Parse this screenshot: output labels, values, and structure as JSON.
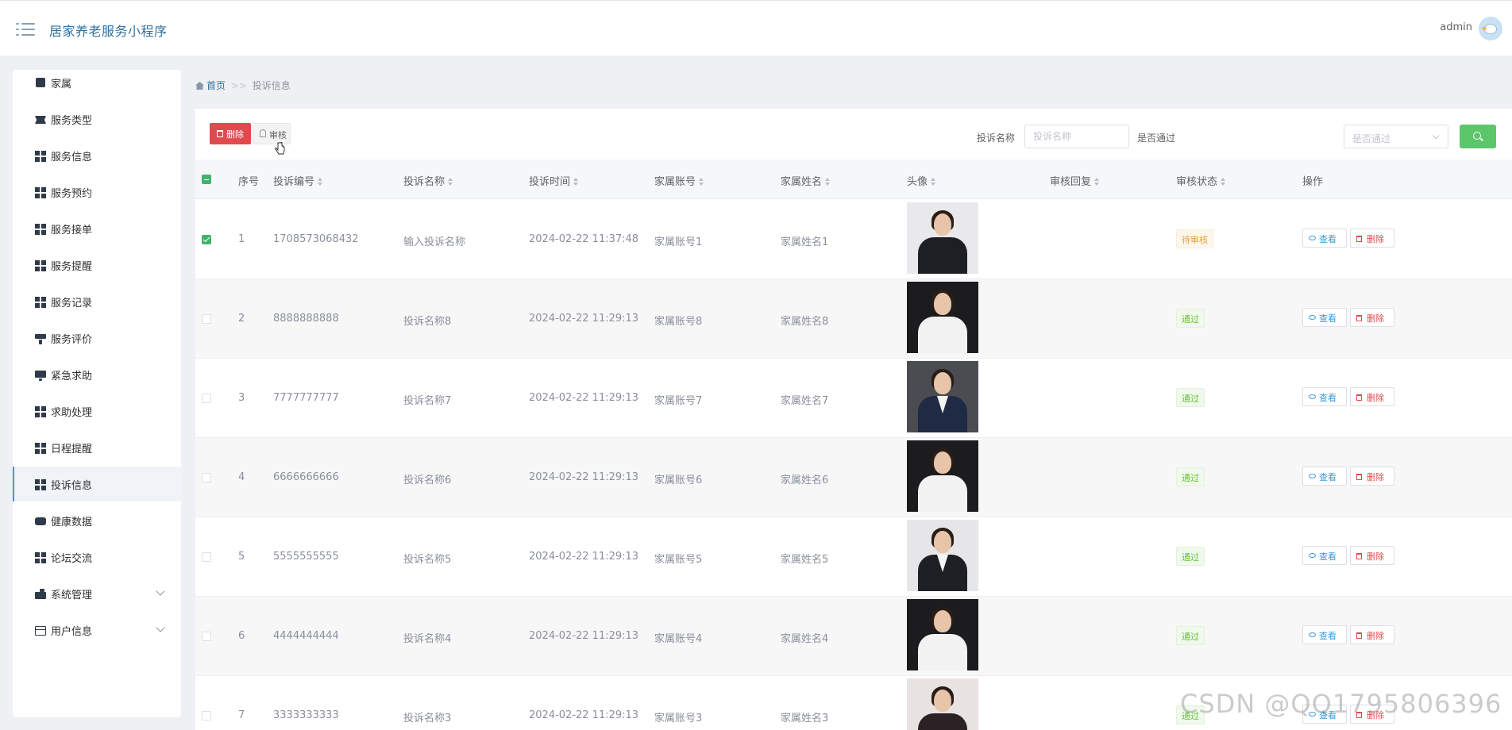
{
  "header": {
    "title": "居家养老服务小程序",
    "user": "admin"
  },
  "sidebar": {
    "items": [
      {
        "label": "家属",
        "icon": "family-icon"
      },
      {
        "label": "服务类型",
        "icon": "ticket-icon"
      },
      {
        "label": "服务信息",
        "icon": "grid-icon"
      },
      {
        "label": "服务预约",
        "icon": "grid-icon"
      },
      {
        "label": "服务接单",
        "icon": "grid-icon"
      },
      {
        "label": "服务提醒",
        "icon": "grid-icon"
      },
      {
        "label": "服务记录",
        "icon": "grid-icon"
      },
      {
        "label": "服务评价",
        "icon": "brush-icon"
      },
      {
        "label": "紧急求助",
        "icon": "monitor-icon"
      },
      {
        "label": "求助处理",
        "icon": "grid-icon"
      },
      {
        "label": "日程提醒",
        "icon": "grid-icon"
      },
      {
        "label": "投诉信息",
        "icon": "grid-icon",
        "active": true
      },
      {
        "label": "健康数据",
        "icon": "tray-icon"
      },
      {
        "label": "论坛交流",
        "icon": "grid-icon"
      },
      {
        "label": "系统管理",
        "icon": "settings-icon",
        "expandable": true
      },
      {
        "label": "用户信息",
        "icon": "card-icon",
        "expandable": true
      }
    ]
  },
  "breadcrumb": {
    "home": "首页",
    "sep": ">>",
    "current": "投诉信息"
  },
  "toolbar": {
    "delete_label": "删除",
    "audit_label": "审核",
    "search_name_label": "投诉名称",
    "search_name_placeholder": "投诉名称",
    "pass_label": "是否通过",
    "pass_placeholder": "是否通过"
  },
  "table": {
    "columns": [
      "序号",
      "投诉编号",
      "投诉名称",
      "投诉时间",
      "家属账号",
      "家属姓名",
      "头像",
      "审核回复",
      "审核状态",
      "操作"
    ],
    "view_label": "查看",
    "delete_label": "删除",
    "rows": [
      {
        "index": "1",
        "code": "1708573068432",
        "name": "输入投诉名称",
        "time": "2024-02-22 11:37:48",
        "account": "家属账号1",
        "fullname": "家属姓名1",
        "reply": "",
        "status": "待审核",
        "status_type": "pending",
        "checked": true,
        "photo": {
          "bg": "#e9e9ec",
          "suit": "#1e1f24",
          "shirt": false
        }
      },
      {
        "index": "2",
        "code": "8888888888",
        "name": "投诉名称8",
        "time": "2024-02-22 11:29:13",
        "account": "家属账号8",
        "fullname": "家属姓名8",
        "reply": "",
        "status": "通过",
        "status_type": "pass",
        "checked": false,
        "photo": {
          "bg": "#1c1c1e",
          "suit": "#f2f2f2",
          "shirt": false
        }
      },
      {
        "index": "3",
        "code": "7777777777",
        "name": "投诉名称7",
        "time": "2024-02-22 11:29:13",
        "account": "家属账号7",
        "fullname": "家属姓名7",
        "reply": "",
        "status": "通过",
        "status_type": "pass",
        "checked": false,
        "photo": {
          "bg": "#4a4c52",
          "suit": "#1f2a44",
          "shirt": true
        }
      },
      {
        "index": "4",
        "code": "6666666666",
        "name": "投诉名称6",
        "time": "2024-02-22 11:29:13",
        "account": "家属账号6",
        "fullname": "家属姓名6",
        "reply": "",
        "status": "通过",
        "status_type": "pass",
        "checked": false,
        "photo": {
          "bg": "#1c1c1e",
          "suit": "#f2f2f2",
          "shirt": false
        }
      },
      {
        "index": "5",
        "code": "5555555555",
        "name": "投诉名称5",
        "time": "2024-02-22 11:29:13",
        "account": "家属账号5",
        "fullname": "家属姓名5",
        "reply": "",
        "status": "通过",
        "status_type": "pass",
        "checked": false,
        "photo": {
          "bg": "#e6e6e8",
          "suit": "#1e1f24",
          "shirt": true
        }
      },
      {
        "index": "6",
        "code": "4444444444",
        "name": "投诉名称4",
        "time": "2024-02-22 11:29:13",
        "account": "家属账号4",
        "fullname": "家属姓名4",
        "reply": "",
        "status": "通过",
        "status_type": "pass",
        "checked": false,
        "photo": {
          "bg": "#1c1c1e",
          "suit": "#f2f2f2",
          "shirt": false
        }
      },
      {
        "index": "7",
        "code": "3333333333",
        "name": "投诉名称3",
        "time": "2024-02-22 11:29:13",
        "account": "家属账号3",
        "fullname": "家属姓名3",
        "reply": "",
        "status": "通过",
        "status_type": "pass",
        "checked": false,
        "photo": {
          "bg": "#e8e2e2",
          "suit": "#2a2224",
          "shirt": false
        }
      }
    ]
  },
  "watermark": "CSDN @QQ1795806396",
  "colors": {
    "accent": "#2f6f9f",
    "danger": "#e04a4e",
    "success": "#5cc66a"
  }
}
